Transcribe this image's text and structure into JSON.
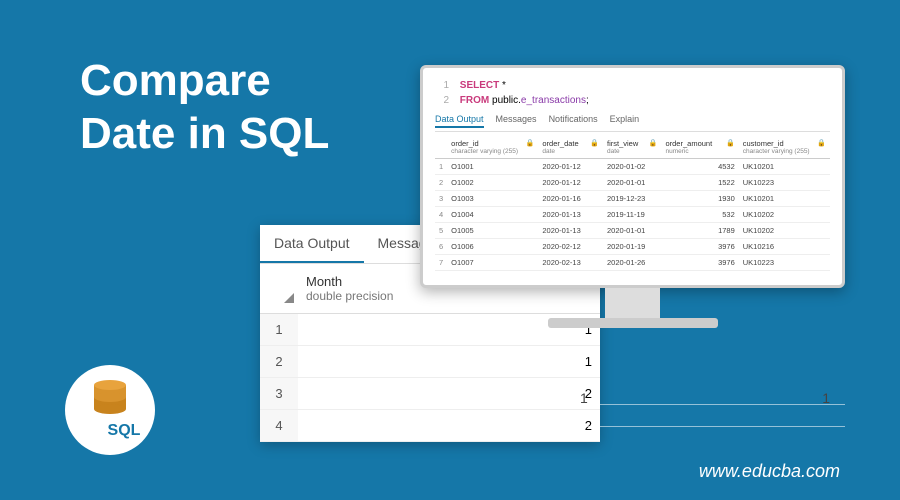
{
  "title_line1": "Compare",
  "title_line2": "Date in SQL",
  "watermark": "www.educba.com",
  "sql_badge": "SQL",
  "back_panel": {
    "tabs": [
      "Data Output",
      "Messages"
    ],
    "column": {
      "name": "Month",
      "type": "double precision"
    },
    "rows": [
      {
        "idx": "1",
        "val": "1"
      },
      {
        "idx": "2",
        "val": "1"
      },
      {
        "idx": "3",
        "val": "2"
      },
      {
        "idx": "4",
        "val": "2"
      }
    ]
  },
  "monitor": {
    "code": {
      "line1": {
        "num": "1",
        "kw": "SELECT",
        "rest": " *"
      },
      "line2": {
        "num": "2",
        "kw": "FROM",
        "schema": " public.",
        "table": "e_transactions",
        "end": ";"
      }
    },
    "tabs": [
      "Data Output",
      "Messages",
      "Notifications",
      "Explain"
    ],
    "columns": [
      {
        "name": "order_id",
        "type": "character varying (255)"
      },
      {
        "name": "order_date",
        "type": "date"
      },
      {
        "name": "first_view",
        "type": "date"
      },
      {
        "name": "order_amount",
        "type": "numeric"
      },
      {
        "name": "customer_id",
        "type": "character varying (255)"
      }
    ],
    "rows": [
      {
        "n": "1",
        "order_id": "O1001",
        "order_date": "2020-01-12",
        "first_view": "2020-01-02",
        "order_amount": "4532",
        "customer_id": "UK10201"
      },
      {
        "n": "2",
        "order_id": "O1002",
        "order_date": "2020-01-12",
        "first_view": "2020-01-01",
        "order_amount": "1522",
        "customer_id": "UK10223"
      },
      {
        "n": "3",
        "order_id": "O1003",
        "order_date": "2020-01-16",
        "first_view": "2019-12-23",
        "order_amount": "1930",
        "customer_id": "UK10201"
      },
      {
        "n": "4",
        "order_id": "O1004",
        "order_date": "2020-01-13",
        "first_view": "2019-11-19",
        "order_amount": "532",
        "customer_id": "UK10202"
      },
      {
        "n": "5",
        "order_id": "O1005",
        "order_date": "2020-01-13",
        "first_view": "2020-01-01",
        "order_amount": "1789",
        "customer_id": "UK10202"
      },
      {
        "n": "6",
        "order_id": "O1006",
        "order_date": "2020-02-12",
        "first_view": "2020-01-19",
        "order_amount": "3976",
        "customer_id": "UK10216"
      },
      {
        "n": "7",
        "order_id": "O1007",
        "order_date": "2020-02-13",
        "first_view": "2020-01-26",
        "order_amount": "3976",
        "customer_id": "UK10223"
      }
    ]
  },
  "decor": {
    "v1": "1",
    "v2": "1"
  }
}
